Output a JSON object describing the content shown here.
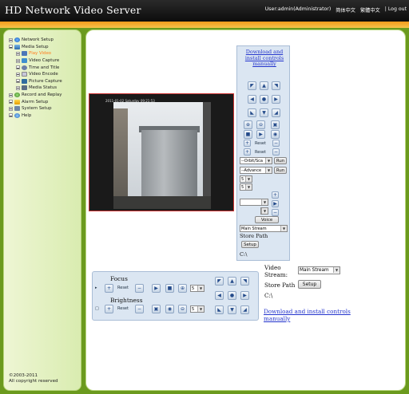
{
  "header": {
    "title": "HD Network Video Server",
    "user": "User:admin(Administrator)",
    "lang_simplified": "简体中文",
    "lang_traditional": "繁體中文",
    "logout": "Log out",
    "separator": "|"
  },
  "sidebar": {
    "items": [
      {
        "label": "Network Setup",
        "level": 0,
        "icon": "globe-icon"
      },
      {
        "label": "Media Setup",
        "level": 0,
        "icon": "media-icon"
      },
      {
        "label": "Play Video",
        "level": 1,
        "icon": "play-video-icon",
        "active": true
      },
      {
        "label": "Video Capture",
        "level": 1,
        "icon": "video-capture-icon"
      },
      {
        "label": "Time and Title",
        "level": 1,
        "icon": "clock-icon"
      },
      {
        "label": "Video Encode",
        "level": 1,
        "icon": "encode-icon"
      },
      {
        "label": "Picture Capture",
        "level": 1,
        "icon": "camera-icon"
      },
      {
        "label": "Media Status",
        "level": 1,
        "icon": "status-icon"
      },
      {
        "label": "Record and Replay",
        "level": 0,
        "icon": "record-icon"
      },
      {
        "label": "Alarm Setup",
        "level": 0,
        "icon": "alarm-icon"
      },
      {
        "label": "System Setup",
        "level": 0,
        "icon": "system-icon"
      },
      {
        "label": "Help",
        "level": 0,
        "icon": "help-icon"
      }
    ],
    "copyright_line1": "©2003-2011",
    "copyright_line2": "All copyright reserved"
  },
  "video": {
    "osd": "2011-01-02 Saturday 09:21:53"
  },
  "ptz": {
    "download_link": "Download and install controls manually",
    "reset1": "Reset",
    "reset2": "Reset",
    "orbit_select": "--Orbit/Sca",
    "orbit_run": "Run",
    "advance_select": "--Advance",
    "advance_run": "Run",
    "sel_a": "5",
    "sel_b": "5",
    "sel_c": "",
    "sel_d": "",
    "voice": "Voice",
    "stream": "Main Stream",
    "store_path_label": "Store Path",
    "setup": "Setup",
    "path": "C:\\"
  },
  "bar": {
    "focus_label": "Focus",
    "brightness_label": "Brightness",
    "reset1": "Reset",
    "reset2": "Reset",
    "speed1": "5",
    "speed2": "5"
  },
  "settings": {
    "video_stream_label": "Video Stream:",
    "stream_value": "Main Stream",
    "store_path_label": "Store Path",
    "setup": "Setup",
    "path": "C:\\",
    "download_link": "Download and install controls manually"
  },
  "colors": {
    "accent": "#f39a1c",
    "page_green": "#6b9a1e",
    "link": "#2233cc",
    "active_item": "#ff7b1a"
  }
}
